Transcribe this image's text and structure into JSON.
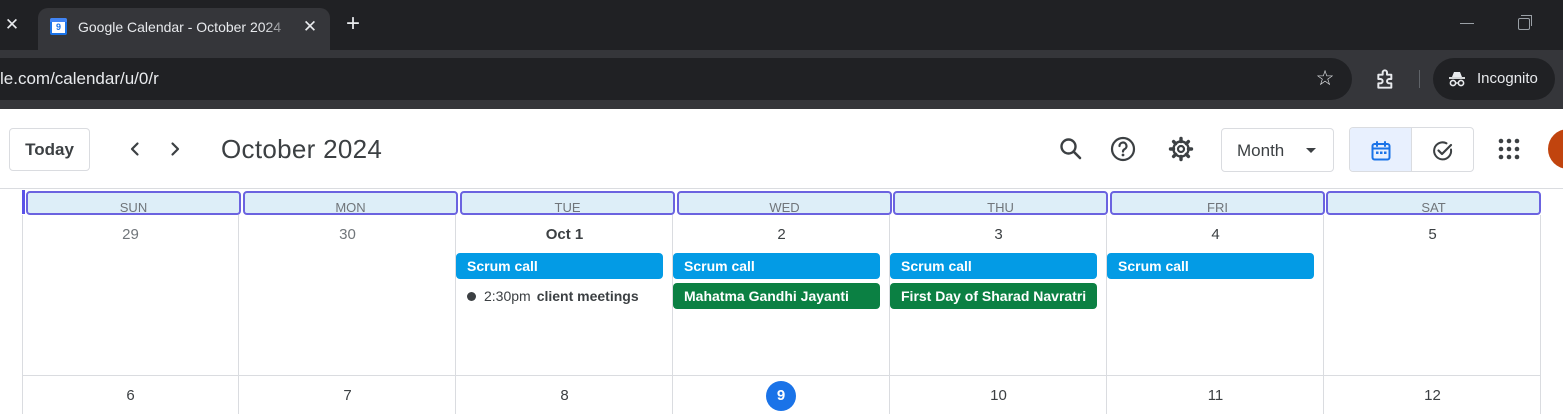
{
  "browser": {
    "tab_title": "Google Calendar - October 2024",
    "tab_favicon_text": "9",
    "url": "le.com/calendar/u/0/r",
    "incognito_label": "Incognito"
  },
  "header": {
    "today_label": "Today",
    "month_title": "October 2024",
    "view_label": "Month"
  },
  "grid": {
    "weekdays": [
      "SUN",
      "MON",
      "TUE",
      "WED",
      "THU",
      "FRI",
      "SAT"
    ],
    "week1": [
      "29",
      "30",
      "Oct 1",
      "2",
      "3",
      "4",
      "5"
    ],
    "week2": [
      "6",
      "7",
      "8",
      "9",
      "10",
      "11",
      "12"
    ],
    "today_index": 3
  },
  "events": {
    "scrum_call": "Scrum call",
    "client_time": "2:30pm",
    "client_title": "client meetings",
    "gandhi": "Mahatma Gandhi Jayanti",
    "navratri": "First Day of Sharad Navratri"
  },
  "colors": {
    "event_blue": "#039be5",
    "holiday_green": "#0b8043",
    "today_blue": "#1a73e8",
    "dayhead_border": "#6b63e0"
  }
}
